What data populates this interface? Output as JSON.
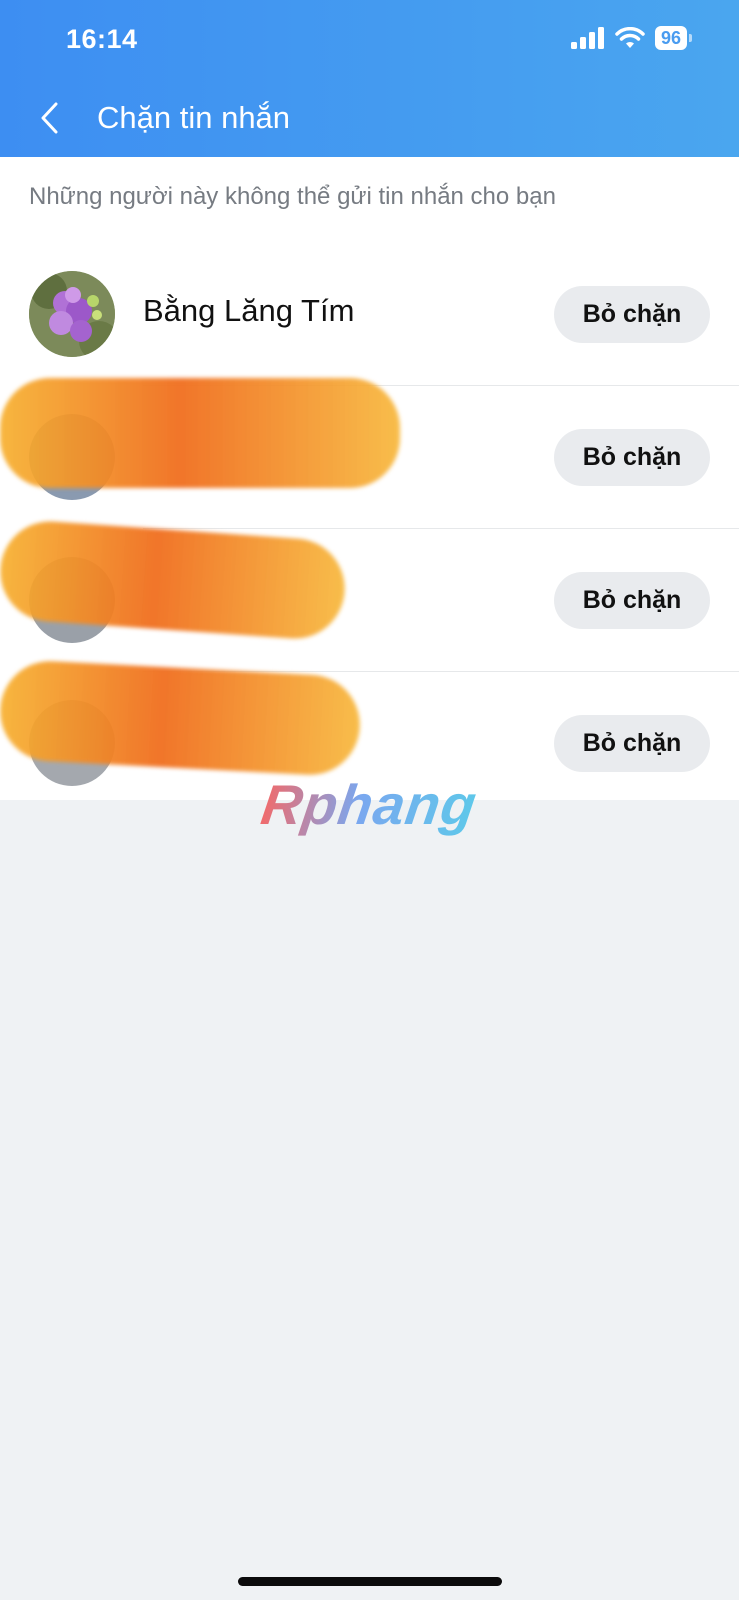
{
  "status_bar": {
    "time": "16:14",
    "battery": "96"
  },
  "header": {
    "title": "Chặn tin nhắn"
  },
  "description": "Những người này không thể gửi tin nhắn cho bạn",
  "blocked_users": [
    {
      "name": "Bằng Lăng Tím",
      "button": "Bỏ chặn"
    },
    {
      "name": "",
      "button": "Bỏ chặn"
    },
    {
      "name": "",
      "button": "Bỏ chặn"
    },
    {
      "name": "",
      "button": "Bỏ chặn"
    }
  ],
  "watermark": "Rphang",
  "colors": {
    "header_start": "#3d8ef2",
    "header_end": "#4aa6ef",
    "button_bg": "#e9ebee",
    "background": "#eff2f4"
  },
  "icons": {
    "back": "chevron-left-icon",
    "signal": "signal-icon",
    "wifi": "wifi-icon",
    "battery": "battery-icon"
  }
}
